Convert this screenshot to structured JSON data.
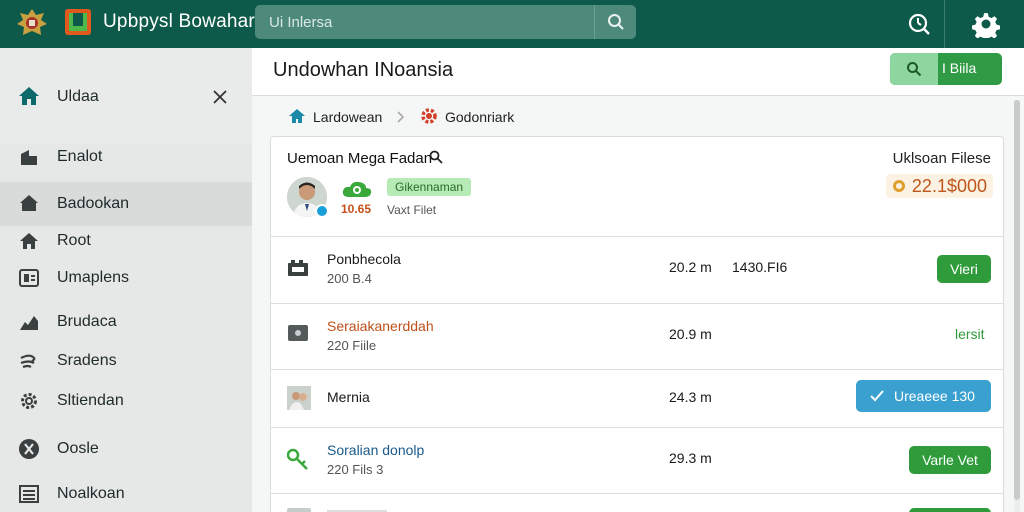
{
  "topbar": {
    "app_title": "Upbpysl Bowahar",
    "search_placeholder": "Ui Inlersa"
  },
  "sidebar": {
    "header_label": "Uldaa",
    "items": [
      {
        "label": "Enalot",
        "icon": "building-icon"
      },
      {
        "label": "Badookan",
        "icon": "house-icon"
      },
      {
        "label": "Root",
        "icon": "home-icon"
      },
      {
        "label": "Umaplens",
        "icon": "grid-icon"
      },
      {
        "label": "Brudaca",
        "icon": "chart-icon"
      },
      {
        "label": "Sradens",
        "icon": "wind-icon"
      },
      {
        "label": "Sltiendan",
        "icon": "gear-icon"
      },
      {
        "label": "Oosle",
        "icon": "compass-icon"
      },
      {
        "label": "Noalkoan",
        "icon": "list-icon"
      }
    ]
  },
  "main": {
    "title": "Undowhan INoansia",
    "action_label": "I Biila",
    "breadcrumb": {
      "first": "Lardowean",
      "second": "Godonriark"
    },
    "card": {
      "title": "Uemoan Mega Fadan",
      "right_title": "Uklsoan Filese",
      "count": "10.65",
      "badge": "Gikennaman",
      "sub": "Vaxt Filet",
      "amount": "22.1$000",
      "rows": [
        {
          "name": "Ponbhecola",
          "meta": "200 B.4",
          "size": "20.2 m",
          "extra": "1430.FI6",
          "action": "Vieri",
          "action_style": "green"
        },
        {
          "name": "Seraiakanerddah",
          "meta": "220 Fiile",
          "size": "20.9 m",
          "extra": "",
          "action": "lersit",
          "action_style": "link"
        },
        {
          "name": "Mernia",
          "meta": "",
          "size": "24.3 m",
          "extra": "",
          "action": "Ureaeee 130",
          "action_style": "blue"
        },
        {
          "name": "Soralian donolp",
          "meta": "220 Fils 3",
          "size": "29.3 m",
          "extra": "",
          "action": "Varle Vet",
          "action_style": "green"
        }
      ]
    }
  },
  "colors": {
    "topbar": "#0e5a4a",
    "accent_green": "#2f9b3a",
    "accent_blue": "#3aa0d0",
    "amount_orange": "#c0561a"
  }
}
